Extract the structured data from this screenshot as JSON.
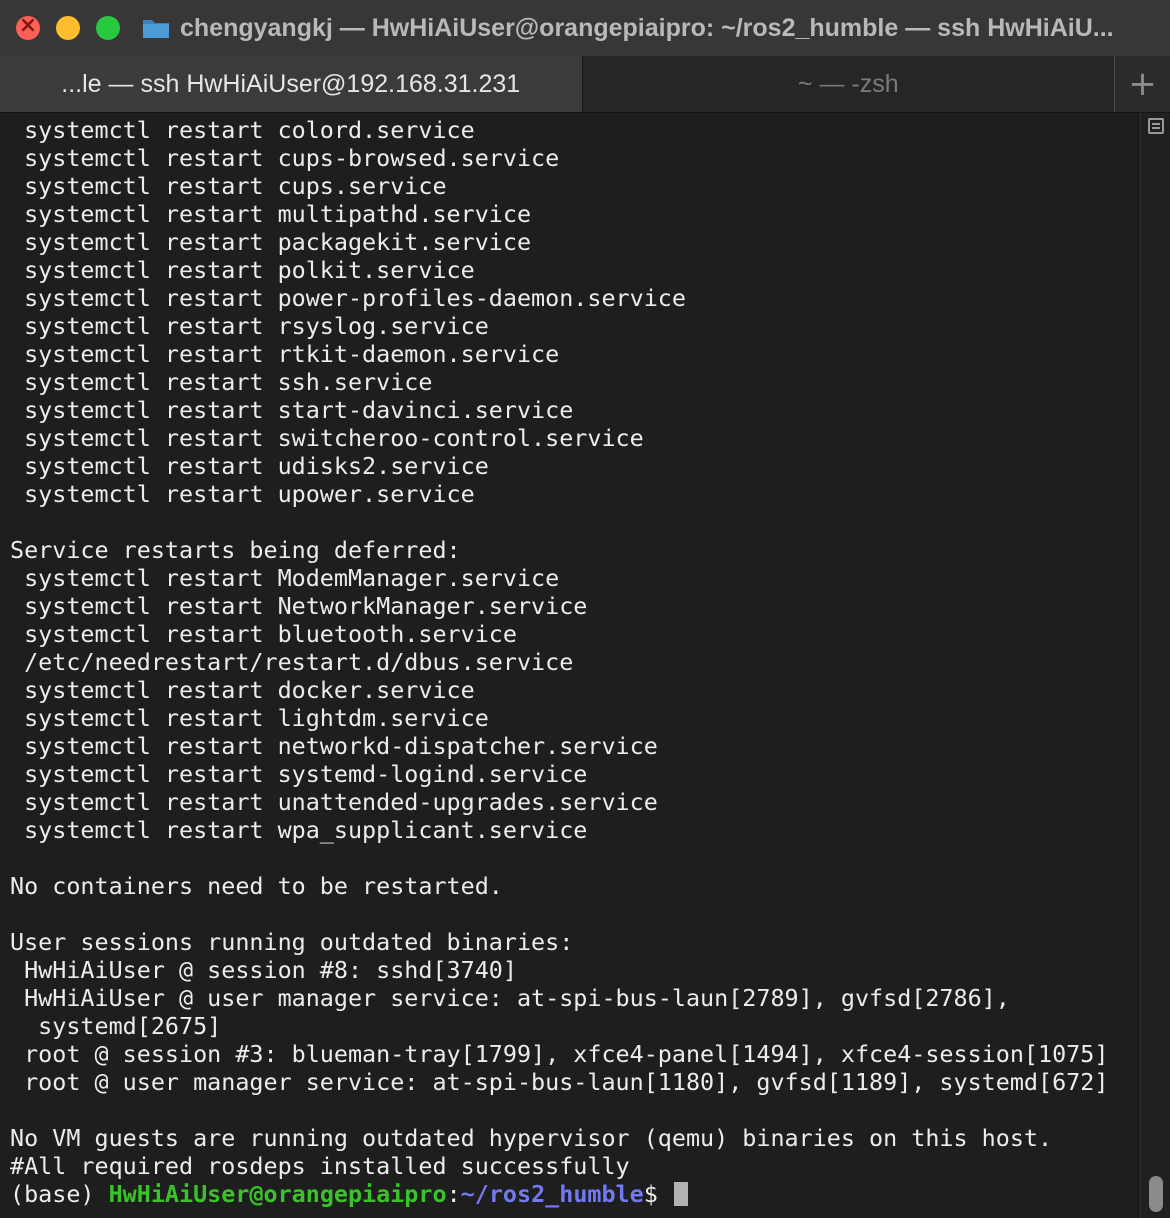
{
  "window": {
    "title": "chengyangkj — HwHiAiUser@orangepiaipro: ~/ros2_humble — ssh HwHiAiU..."
  },
  "tabs": [
    {
      "label": "...le — ssh HwHiAiUser@192.168.31.231",
      "active": true
    },
    {
      "label": "~ — -zsh",
      "active": false
    }
  ],
  "tab_add_label": "+",
  "terminal": {
    "lines": [
      " systemctl restart colord.service",
      " systemctl restart cups-browsed.service",
      " systemctl restart cups.service",
      " systemctl restart multipathd.service",
      " systemctl restart packagekit.service",
      " systemctl restart polkit.service",
      " systemctl restart power-profiles-daemon.service",
      " systemctl restart rsyslog.service",
      " systemctl restart rtkit-daemon.service",
      " systemctl restart ssh.service",
      " systemctl restart start-davinci.service",
      " systemctl restart switcheroo-control.service",
      " systemctl restart udisks2.service",
      " systemctl restart upower.service",
      "",
      "Service restarts being deferred:",
      " systemctl restart ModemManager.service",
      " systemctl restart NetworkManager.service",
      " systemctl restart bluetooth.service",
      " /etc/needrestart/restart.d/dbus.service",
      " systemctl restart docker.service",
      " systemctl restart lightdm.service",
      " systemctl restart networkd-dispatcher.service",
      " systemctl restart systemd-logind.service",
      " systemctl restart unattended-upgrades.service",
      " systemctl restart wpa_supplicant.service",
      "",
      "No containers need to be restarted.",
      "",
      "User sessions running outdated binaries:",
      " HwHiAiUser @ session #8: sshd[3740]",
      " HwHiAiUser @ user manager service: at-spi-bus-laun[2789], gvfsd[2786],",
      "  systemd[2675]",
      " root @ session #3: blueman-tray[1799], xfce4-panel[1494], xfce4-session[1075]",
      " root @ user manager service: at-spi-bus-laun[1180], gvfsd[1189], systemd[672]",
      "",
      "No VM guests are running outdated hypervisor (qemu) binaries on this host.",
      "#All required rosdeps installed successfully"
    ],
    "prompt": {
      "env": "(base) ",
      "user_host": "HwHiAiUser@orangepiaipro",
      "separator": ":",
      "path": "~/ros2_humble",
      "symbol": "$ "
    }
  },
  "colors": {
    "prompt_user": "#39c229",
    "prompt_path": "#7379f3",
    "close": "#fe5f57",
    "minimize": "#febc2e",
    "maximize": "#28c840"
  }
}
